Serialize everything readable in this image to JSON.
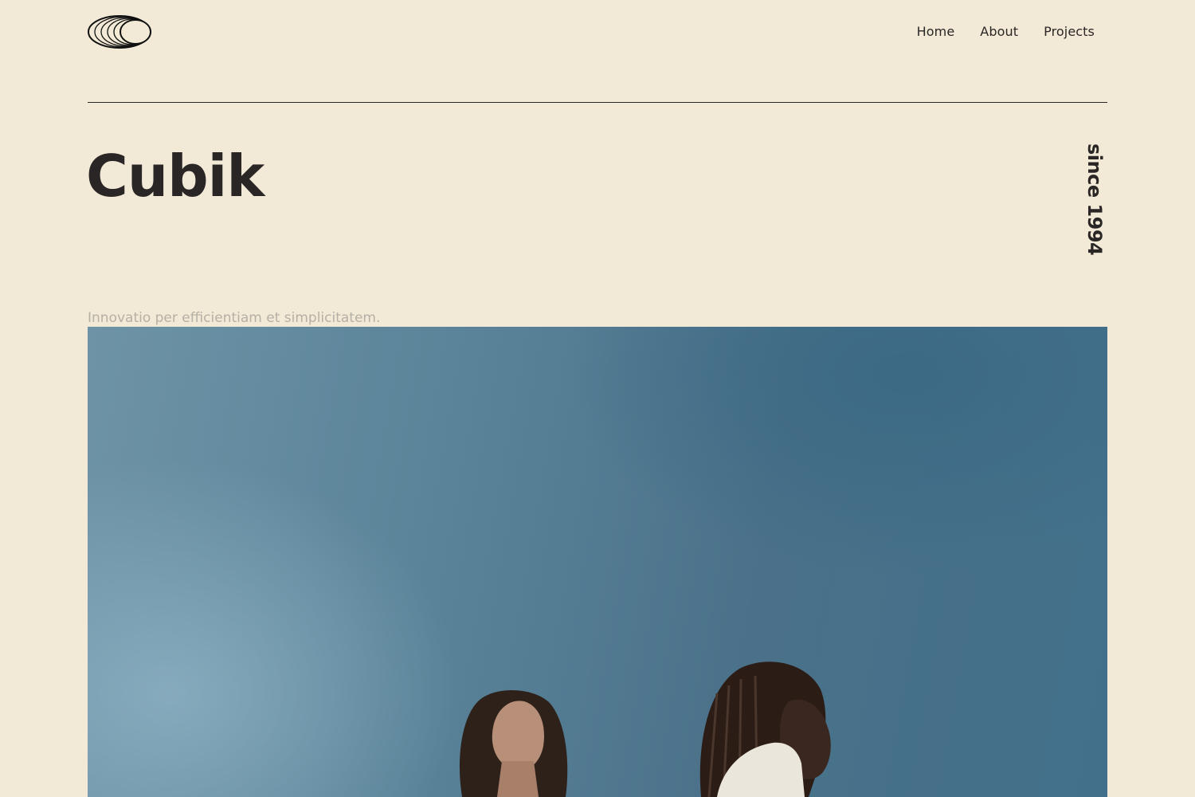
{
  "header": {
    "logo_icon": "concentric-ellipses-logo-icon",
    "nav": [
      {
        "label": "Home"
      },
      {
        "label": "About"
      },
      {
        "label": "Projects"
      }
    ]
  },
  "hero": {
    "title": "Cubik",
    "since": "since 1994",
    "tagline": "Innovatio per efficientiam et simplicitatem.",
    "photo": "two-women-under-blue-sky-photo"
  },
  "colors": {
    "background": "#f2ead6",
    "text": "#2a2626",
    "muted_text": "#b5b0a6",
    "sky": "#4f7a92"
  }
}
